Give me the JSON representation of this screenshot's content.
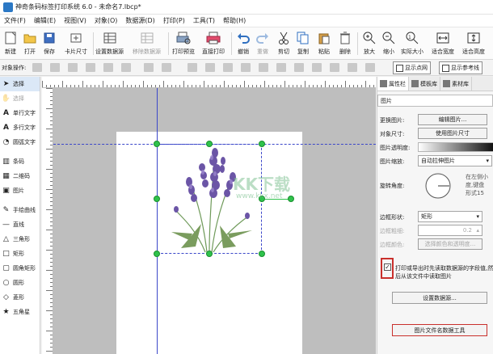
{
  "window": {
    "title": "神奇条码标签打印系统 6.0 - 未命名7.lbcp*"
  },
  "menu": [
    "文件(F)",
    "编辑(E)",
    "视图(V)",
    "对象(O)",
    "数据源(D)",
    "打印(P)",
    "工具(T)",
    "帮助(H)"
  ],
  "toolbar": {
    "new": "新建",
    "open": "打开",
    "save": "保存",
    "card_size": "卡片尺寸",
    "set_datasource": "设置数据源",
    "remove_datasource": "移除数据源",
    "print_preview": "打印预览",
    "direct_print": "直接打印",
    "undo": "撤销",
    "redo": "重做",
    "cut": "剪切",
    "copy": "复制",
    "paste": "粘贴",
    "delete": "删除",
    "zoom_in": "放大",
    "zoom_out": "缩小",
    "actual_size": "实际大小",
    "fit_width": "适合宽度",
    "fit_height": "适合高度"
  },
  "optbar": {
    "label": "对象操作:",
    "show_grid": "显示点网",
    "show_ref": "显示参考线"
  },
  "tools": [
    "选择",
    "选择",
    "单行文字",
    "多行文字",
    "圆弧文字",
    "条码",
    "二维码",
    "图片",
    "手绘曲线",
    "直线",
    "三角形",
    "矩形",
    "圆角矩形",
    "圆形",
    "菱形",
    "五角星"
  ],
  "canvas": {
    "watermark": "KK下载",
    "watermark_url": "www.kkx.net"
  },
  "props": {
    "tabs": [
      "属性栏",
      "模板库",
      "素材库"
    ],
    "section": "图片",
    "change_image_label": "更换图片:",
    "change_image_btn": "编辑图片...",
    "object_size_label": "对象尺寸:",
    "object_size_btn": "使用图片尺寸",
    "opacity_label": "图片透明度:",
    "scale_label": "图片缩放:",
    "scale_value": "自动拉伸图片",
    "rotate_label": "旋转角度:",
    "rotate_note_1": "在左侧小",
    "rotate_note_2": "度,键盘",
    "rotate_note_3": "形式15",
    "border_shape_label": "边框形状:",
    "border_shape_value": "矩形",
    "border_width_label": "边框粗细:",
    "border_width_value": "0.2",
    "border_color_label": "边框颜色:",
    "border_color_btn": "选择颜色和透明度...",
    "checkbox_text": "打印或导出时先读取数据源的字段值,然后从该文件中读取图片",
    "set_datasource_btn": "设置数据源...",
    "bottom_btn": "图片文件名数据工具"
  }
}
